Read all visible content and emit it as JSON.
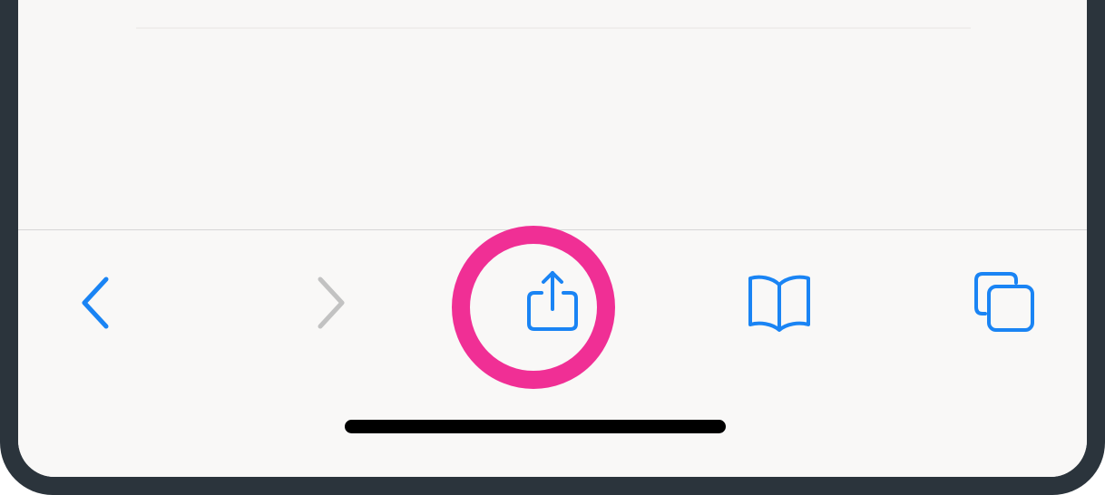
{
  "toolbar": {
    "buttons": [
      {
        "name": "back",
        "icon": "chevron-left-icon",
        "enabled": true
      },
      {
        "name": "forward",
        "icon": "chevron-right-icon",
        "enabled": false
      },
      {
        "name": "share",
        "icon": "share-icon",
        "enabled": true,
        "highlighted": true
      },
      {
        "name": "bookmarks",
        "icon": "book-icon",
        "enabled": true
      },
      {
        "name": "tabs",
        "icon": "tabs-icon",
        "enabled": true
      }
    ]
  },
  "colors": {
    "accent": "#1a84f4",
    "disabled": "#c2c2c2",
    "highlight": "#f02f95",
    "frame": "#2b343c",
    "background": "#f8f7f6"
  }
}
